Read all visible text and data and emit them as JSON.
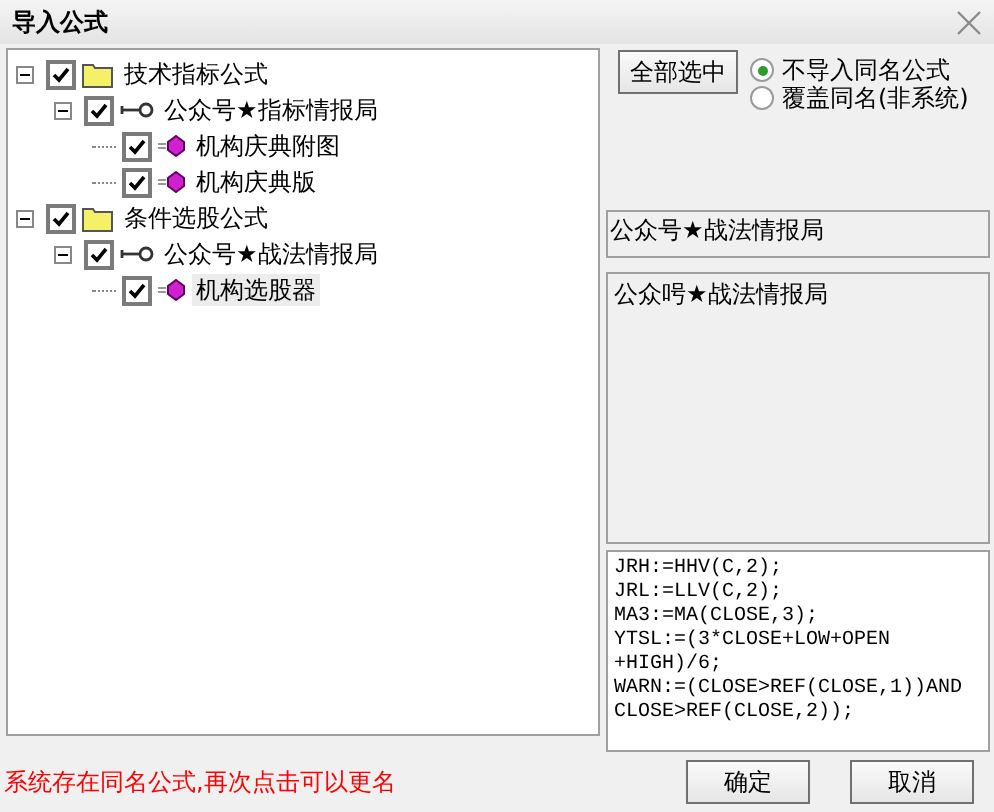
{
  "window": {
    "title": "导入公式"
  },
  "tree": [
    {
      "kind": "folder",
      "label": "技术指标公式",
      "checked": true,
      "expanded": true,
      "selected": false,
      "children": [
        {
          "kind": "group",
          "label": "公众号★指标情报局",
          "checked": true,
          "expanded": true,
          "selected": false,
          "children": [
            {
              "kind": "formula",
              "label": "机构庆典附图",
              "checked": true,
              "selected": false
            },
            {
              "kind": "formula",
              "label": "机构庆典版",
              "checked": true,
              "selected": false
            }
          ]
        }
      ]
    },
    {
      "kind": "folder",
      "label": "条件选股公式",
      "checked": true,
      "expanded": true,
      "selected": false,
      "children": [
        {
          "kind": "group",
          "label": "公众号★战法情报局",
          "checked": true,
          "expanded": true,
          "selected": false,
          "children": [
            {
              "kind": "formula",
              "label": "机构选股器",
              "checked": true,
              "selected": true
            }
          ]
        }
      ]
    }
  ],
  "select_all_button": "全部选中",
  "options": [
    {
      "label": "不导入同名公式",
      "selected": true
    },
    {
      "label": "覆盖同名(非系统)",
      "selected": false
    }
  ],
  "name_field": {
    "value": "公众号★战法情报局"
  },
  "description": "公众呺★战法情报局",
  "source_code": [
    "JRH:=HHV(C,2);",
    "JRL:=LLV(C,2);",
    "MA3:=MA(CLOSE,3);",
    "YTSL:=(3*CLOSE+LOW+OPEN",
    "+HIGH)/6;",
    "WARN:=(CLOSE>REF(CLOSE,1))AND",
    "CLOSE>REF(CLOSE,2));"
  ],
  "status_message": "系统存在同名公式,再次点击可以更名",
  "buttons": [
    "确定",
    "取消"
  ]
}
